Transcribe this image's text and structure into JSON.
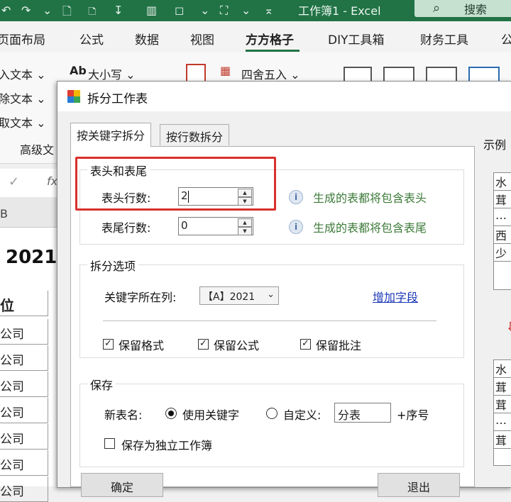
{
  "titlebar": {
    "title": "工作簿1  -  Excel",
    "search_label": "搜索"
  },
  "ribbon_tabs": [
    "页面布局",
    "公式",
    "数据",
    "视图",
    "方方格子",
    "DIY工具箱",
    "财务工具",
    "公"
  ],
  "ribbon": {
    "left_items": [
      "入文本 ⌄",
      "除文本 ⌄",
      "取文本 ⌄"
    ],
    "advanced_text": "高级文",
    "case_label": "大小写 ⌄",
    "round_label": "四舍五入 ⌄"
  },
  "sheet": {
    "col_header": "B",
    "year": "2021",
    "header_cell": "位",
    "rows": [
      "公司",
      "公司",
      "公司",
      "公司",
      "公司",
      "公司",
      "公司"
    ]
  },
  "dialog": {
    "title": "拆分工作表",
    "tabs": [
      "按关键字拆分",
      "按行数拆分"
    ],
    "header_footer": {
      "group_title": "表头和表尾",
      "header_rows_label": "表头行数:",
      "header_rows_value": "2",
      "footer_rows_label": "表尾行数:",
      "footer_rows_value": "0",
      "header_hint": "生成的表都将包含表头",
      "footer_hint": "生成的表都将包含表尾"
    },
    "split_options": {
      "group_title": "拆分选项",
      "keyword_col_label": "关键字所在列:",
      "keyword_col_value": "【A】2021",
      "add_field_link": "增加字段",
      "keep_format": "保留格式",
      "keep_formula": "保留公式",
      "keep_comment": "保留批注"
    },
    "save": {
      "group_title": "保存",
      "new_name_label": "新表名:",
      "use_keyword": "使用关键字",
      "custom": "自定义:",
      "custom_value": "分表",
      "suffix": "+序号",
      "save_independent": "保存为独立工作簿"
    },
    "buttons": {
      "ok": "确定",
      "exit": "退出"
    },
    "example": {
      "title": "示例",
      "top_rows": [
        "水",
        "茸",
        "…",
        "西",
        "少"
      ],
      "bottom_rows": [
        "水",
        "茸",
        "茸",
        "…",
        "茸"
      ]
    }
  },
  "colors": {
    "excel_green": "#217346",
    "highlight_red": "#d9302c",
    "hint_green": "#3c7a38",
    "link_blue": "#1a36b5"
  }
}
